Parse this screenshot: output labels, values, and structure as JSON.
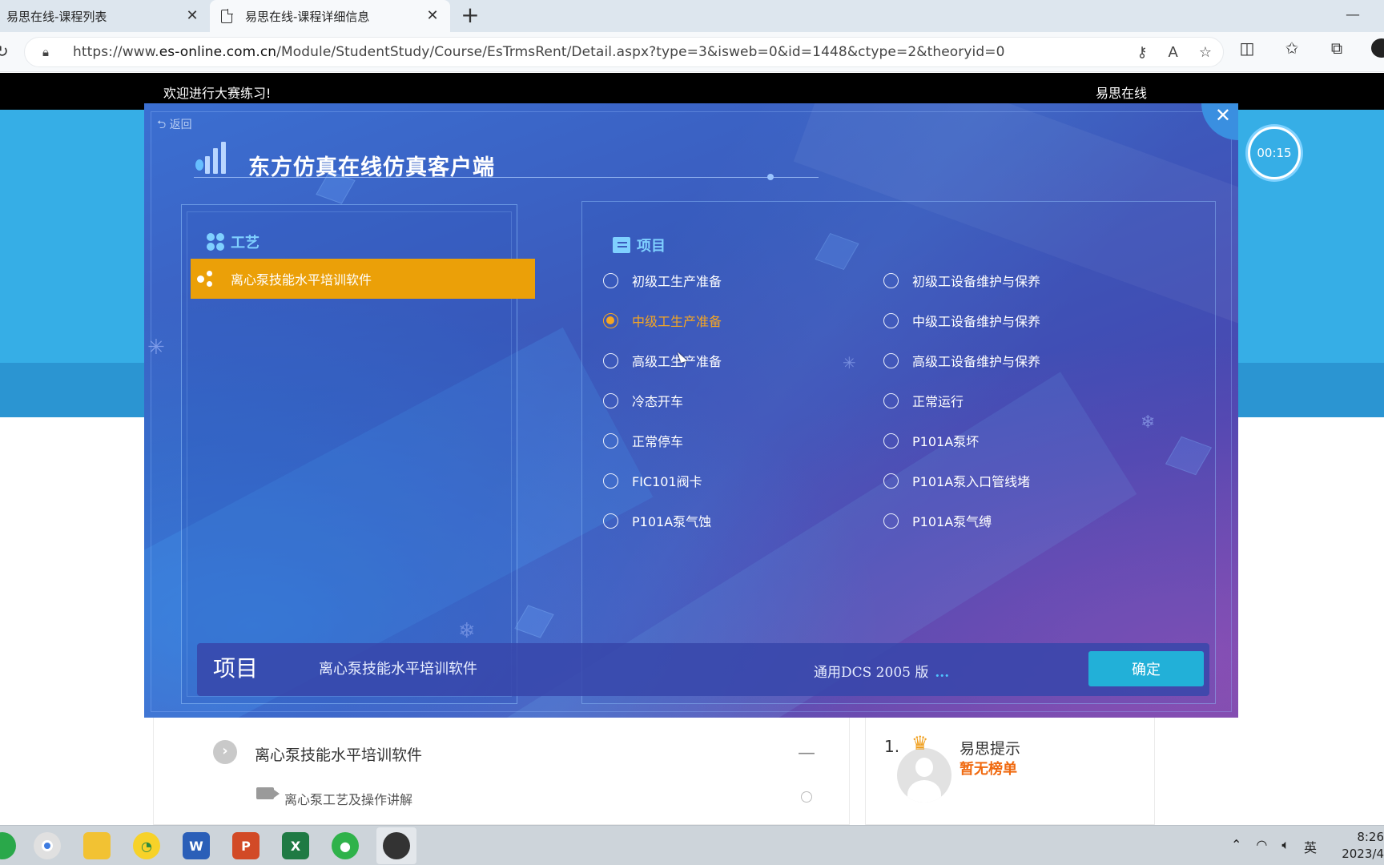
{
  "browser": {
    "tabs": [
      {
        "label": "易思在线-课程列表",
        "close": "✕"
      },
      {
        "label": "易思在线-课程详细信息",
        "close": "✕"
      }
    ],
    "new_tab": "+",
    "minimize": "—",
    "url_host_prefix": "https://www.",
    "url_host": "es-online.com.cn",
    "url_path": "/Module/StudentStudy/Course/EsTrmsRent/Detail.aspx?type=3&isweb=0&id=1448&ctype=2&theoryid=0"
  },
  "site": {
    "welcome": "欢迎进行大赛练习!",
    "brand": "易思在线",
    "timer": "00:15",
    "course_title": "离心泵技能水平培训软件",
    "collapse": "—",
    "lesson_title": "离心泵工艺及操作讲解",
    "rank": {
      "number": "1.",
      "name": "易思提示",
      "empty_text": "暂无榜单"
    }
  },
  "modal": {
    "back": "返回",
    "close": "✕",
    "title": "东方仿真在线仿真客户端",
    "process_section": "工艺",
    "process_items": [
      "离心泵技能水平培训软件"
    ],
    "project_section": "项目",
    "projects_left": [
      {
        "label": "初级工生产准备",
        "selected": false
      },
      {
        "label": "中级工生产准备",
        "selected": true
      },
      {
        "label": "高级工生产准备",
        "selected": false
      },
      {
        "label": "冷态开车",
        "selected": false
      },
      {
        "label": "正常停车",
        "selected": false
      },
      {
        "label": "FIC101阀卡",
        "selected": false
      },
      {
        "label": "P101A泵气蚀",
        "selected": false
      }
    ],
    "projects_right": [
      {
        "label": "初级工设备维护与保养",
        "selected": false
      },
      {
        "label": "中级工设备维护与保养",
        "selected": false
      },
      {
        "label": "高级工设备维护与保养",
        "selected": false
      },
      {
        "label": "正常运行",
        "selected": false
      },
      {
        "label": "P101A泵坏",
        "selected": false
      },
      {
        "label": "P101A泵入口管线堵",
        "selected": false
      },
      {
        "label": "P101A泵气缚",
        "selected": false
      }
    ],
    "footer": {
      "label": "项目",
      "software": "离心泵技能水平培训软件",
      "version": "通用DCS 2005 版",
      "more": "...",
      "confirm": "确定"
    }
  },
  "taskbar": {
    "ime": "英",
    "time": "8:26",
    "date": "2023/4"
  },
  "colors": {
    "selected_accent": "#f5a623",
    "process_highlight": "#eba008",
    "confirm_button": "#22b0d8",
    "section_heading": "#7fd0ff",
    "banner_blue": "#36aee6"
  }
}
